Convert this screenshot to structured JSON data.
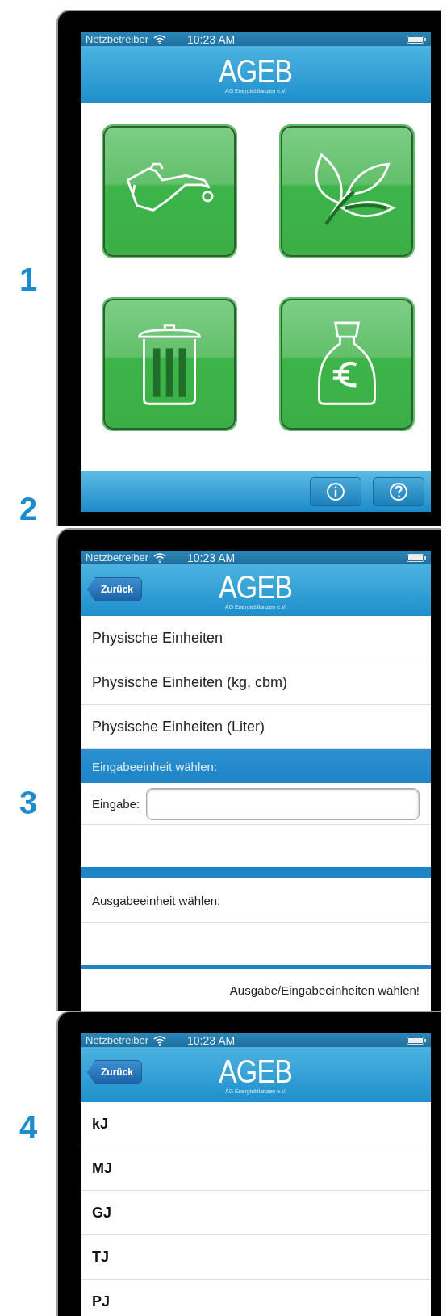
{
  "screens": [
    {
      "kind": "home",
      "markers": [
        "1",
        "2"
      ],
      "status_bar": {
        "carrier": "Netzbetreiber",
        "time": "10:23 AM"
      },
      "nav_bar": {
        "title": "AGEB",
        "subtitle": "AG Energiebilanzen e.V."
      },
      "tiles": [
        {
          "kind": "oil"
        },
        {
          "kind": "leaf"
        },
        {
          "kind": "waste"
        },
        {
          "kind": "money"
        }
      ],
      "toolbar_buttons": [
        {
          "kind": "info"
        },
        {
          "kind": "help"
        }
      ]
    },
    {
      "kind": "form",
      "markers": [
        "3"
      ],
      "status_bar": {
        "carrier": "Netzbetreiber",
        "time": "10:23 AM"
      },
      "nav_bar": {
        "title": "AGEB",
        "subtitle": "AG Energiebilanzen e.V.",
        "back": "Zurück"
      },
      "rows": [
        {
          "kind": "item",
          "label": "Physische Einheiten"
        },
        {
          "kind": "item",
          "label": "Physische Einheiten (kg, cbm)"
        },
        {
          "kind": "item",
          "label": "Physische Einheiten (Liter)"
        },
        {
          "kind": "header",
          "label": "Eingabeeinheit wählen:"
        },
        {
          "kind": "input",
          "label": "Eingabe:"
        },
        {
          "kind": "empty"
        },
        {
          "kind": "divider"
        },
        {
          "kind": "plain",
          "label": "Ausgabeeinheit wählen:"
        },
        {
          "kind": "empty"
        },
        {
          "kind": "thin-divider"
        },
        {
          "kind": "note",
          "label": "Ausgabe/Eingabeeinheiten wählen!"
        }
      ]
    },
    {
      "kind": "list",
      "markers": [
        "4"
      ],
      "status_bar": {
        "carrier": "Netzbetreiber",
        "time": "10:23 AM"
      },
      "nav_bar": {
        "title": "AGEB",
        "subtitle": "AG Energiebilanzen e.V.",
        "back": "Zurück"
      },
      "rows": [
        {
          "kind": "unit",
          "label": "kJ"
        },
        {
          "kind": "unit",
          "label": "MJ"
        },
        {
          "kind": "unit",
          "label": "GJ"
        },
        {
          "kind": "unit",
          "label": "TJ"
        },
        {
          "kind": "unit",
          "label": "PJ"
        }
      ]
    }
  ]
}
